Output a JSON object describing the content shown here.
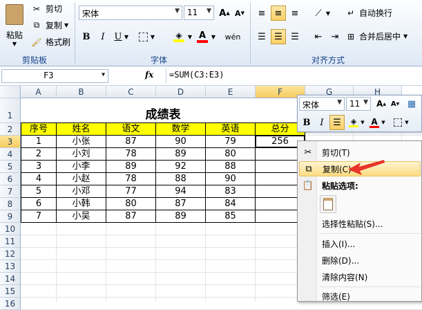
{
  "ribbon": {
    "clipboard": {
      "cut": "剪切",
      "copy": "复制",
      "format_painter": "格式刷",
      "paste": "粘贴",
      "label": "剪贴板"
    },
    "font": {
      "family": "宋体",
      "size": "11",
      "label": "字体",
      "bold": "B",
      "italic": "I",
      "underline": "U"
    },
    "alignment": {
      "wrap": "自动换行",
      "merge": "合并后居中",
      "label": "对齐方式"
    }
  },
  "formula_bar": {
    "name_box": "F3",
    "fx": "fx",
    "formula": "=SUM(C3:E3)"
  },
  "columns": [
    "A",
    "B",
    "C",
    "D",
    "E",
    "F",
    "G",
    "H"
  ],
  "rows": [
    "1",
    "2",
    "3",
    "4",
    "5",
    "6",
    "7",
    "8",
    "9",
    "10",
    "11",
    "12",
    "13",
    "14",
    "15",
    "16"
  ],
  "sheet": {
    "title": "成绩表",
    "headers": [
      "序号",
      "姓名",
      "语文",
      "数学",
      "英语",
      "总分"
    ],
    "records": [
      [
        "1",
        "小张",
        "87",
        "90",
        "79",
        "256"
      ],
      [
        "2",
        "小刘",
        "78",
        "89",
        "80",
        ""
      ],
      [
        "3",
        "小李",
        "89",
        "92",
        "88",
        ""
      ],
      [
        "4",
        "小赵",
        "78",
        "88",
        "90",
        ""
      ],
      [
        "5",
        "小邓",
        "77",
        "94",
        "83",
        ""
      ],
      [
        "6",
        "小韩",
        "80",
        "87",
        "84",
        ""
      ],
      [
        "7",
        "小吴",
        "87",
        "89",
        "85",
        ""
      ]
    ]
  },
  "mini_toolbar": {
    "font": "宋体",
    "size": "11",
    "bold": "B",
    "italic": "I"
  },
  "context_menu": {
    "cut": "剪切(T)",
    "copy": "复制(C)",
    "paste_options": "粘贴选项:",
    "paste_special": "选择性粘贴(S)...",
    "insert": "插入(I)...",
    "delete": "删除(D)...",
    "clear": "清除内容(N)",
    "filter": "筛选(E)"
  },
  "colors": {
    "header_fill": "#ffff00",
    "arrow": "#e8342a",
    "hover": "#fbdc82"
  }
}
